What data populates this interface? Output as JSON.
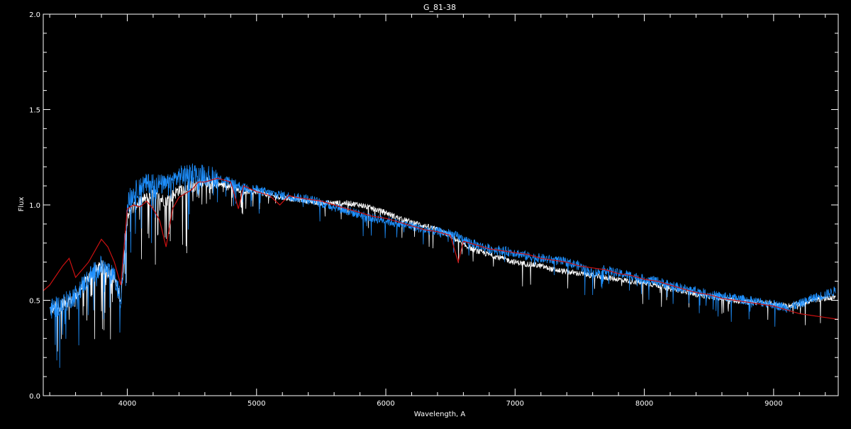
{
  "chart_data": {
    "type": "line",
    "title": "G_81-38",
    "xlabel": "Wavelength, A",
    "ylabel": "Flux",
    "xlim": [
      3350,
      9500
    ],
    "ylim": [
      0.0,
      2.0
    ],
    "x_ticks": [
      4000,
      5000,
      6000,
      7000,
      8000,
      9000
    ],
    "x_tick_labels": [
      "4000",
      "5000",
      "6000",
      "7000",
      "8000",
      "9000"
    ],
    "x_minor_step": 200,
    "y_ticks": [
      0.0,
      0.5,
      1.0,
      1.5,
      2.0
    ],
    "y_tick_labels": [
      "0.0",
      "0.5",
      "1.0",
      "1.5",
      "2.0"
    ],
    "y_minor_step": 0.1,
    "grid": false,
    "legend": "none",
    "background_color": "#000000",
    "axis_color": "#ffffff",
    "series": [
      {
        "color": "#ffffff",
        "points": [
          [
            3400,
            0.45
          ],
          [
            3500,
            0.48
          ],
          [
            3600,
            0.52
          ],
          [
            3700,
            0.62
          ],
          [
            3800,
            0.68
          ],
          [
            3900,
            0.62
          ],
          [
            3950,
            0.5
          ],
          [
            4000,
            0.95
          ],
          [
            4100,
            1.02
          ],
          [
            4200,
            1.05
          ],
          [
            4300,
            1.02
          ],
          [
            4400,
            1.08
          ],
          [
            4500,
            1.1
          ],
          [
            4600,
            1.12
          ],
          [
            4700,
            1.11
          ],
          [
            4800,
            1.1
          ],
          [
            4900,
            1.07
          ],
          [
            5000,
            1.07
          ],
          [
            5100,
            1.05
          ],
          [
            5200,
            1.04
          ],
          [
            5300,
            1.03
          ],
          [
            5400,
            1.02
          ],
          [
            5500,
            1.01
          ],
          [
            5600,
            1.01
          ],
          [
            5700,
            1.01
          ],
          [
            5800,
            1.0
          ],
          [
            5900,
            0.98
          ],
          [
            6000,
            0.96
          ],
          [
            6100,
            0.93
          ],
          [
            6200,
            0.91
          ],
          [
            6300,
            0.89
          ],
          [
            6400,
            0.87
          ],
          [
            6500,
            0.84
          ],
          [
            6600,
            0.79
          ],
          [
            6700,
            0.76
          ],
          [
            6800,
            0.74
          ],
          [
            6900,
            0.72
          ],
          [
            7000,
            0.7
          ],
          [
            7100,
            0.69
          ],
          [
            7200,
            0.68
          ],
          [
            7300,
            0.66
          ],
          [
            7400,
            0.65
          ],
          [
            7500,
            0.64
          ],
          [
            7600,
            0.63
          ],
          [
            7700,
            0.62
          ],
          [
            7800,
            0.61
          ],
          [
            7900,
            0.6
          ],
          [
            8000,
            0.59
          ],
          [
            8100,
            0.58
          ],
          [
            8200,
            0.56
          ],
          [
            8300,
            0.55
          ],
          [
            8400,
            0.53
          ],
          [
            8500,
            0.52
          ],
          [
            8600,
            0.51
          ],
          [
            8700,
            0.5
          ],
          [
            8800,
            0.49
          ],
          [
            8900,
            0.49
          ],
          [
            9000,
            0.48
          ],
          [
            9100,
            0.47
          ],
          [
            9200,
            0.48
          ],
          [
            9300,
            0.5
          ],
          [
            9400,
            0.51
          ],
          [
            9480,
            0.52
          ]
        ]
      },
      {
        "color": "#1e90ff",
        "points": [
          [
            3400,
            0.45
          ],
          [
            3500,
            0.48
          ],
          [
            3600,
            0.53
          ],
          [
            3700,
            0.62
          ],
          [
            3800,
            0.68
          ],
          [
            3900,
            0.62
          ],
          [
            3950,
            0.5
          ],
          [
            4000,
            1.02
          ],
          [
            4100,
            1.1
          ],
          [
            4200,
            1.12
          ],
          [
            4300,
            1.1
          ],
          [
            4400,
            1.15
          ],
          [
            4500,
            1.17
          ],
          [
            4600,
            1.16
          ],
          [
            4700,
            1.14
          ],
          [
            4800,
            1.12
          ],
          [
            4900,
            1.09
          ],
          [
            5000,
            1.08
          ],
          [
            5100,
            1.06
          ],
          [
            5200,
            1.05
          ],
          [
            5300,
            1.04
          ],
          [
            5400,
            1.03
          ],
          [
            5500,
            1.01
          ],
          [
            5600,
            0.99
          ],
          [
            5700,
            0.97
          ],
          [
            5800,
            0.95
          ],
          [
            5900,
            0.93
          ],
          [
            6000,
            0.92
          ],
          [
            6100,
            0.9
          ],
          [
            6200,
            0.89
          ],
          [
            6300,
            0.87
          ],
          [
            6400,
            0.86
          ],
          [
            6500,
            0.85
          ],
          [
            6600,
            0.82
          ],
          [
            6700,
            0.79
          ],
          [
            6800,
            0.77
          ],
          [
            6900,
            0.76
          ],
          [
            7000,
            0.75
          ],
          [
            7100,
            0.73
          ],
          [
            7200,
            0.72
          ],
          [
            7300,
            0.71
          ],
          [
            7400,
            0.7
          ],
          [
            7500,
            0.68
          ],
          [
            7600,
            0.64
          ],
          [
            7700,
            0.66
          ],
          [
            7800,
            0.64
          ],
          [
            7900,
            0.63
          ],
          [
            8000,
            0.61
          ],
          [
            8100,
            0.6
          ],
          [
            8200,
            0.58
          ],
          [
            8300,
            0.56
          ],
          [
            8400,
            0.55
          ],
          [
            8500,
            0.53
          ],
          [
            8600,
            0.52
          ],
          [
            8700,
            0.51
          ],
          [
            8800,
            0.5
          ],
          [
            8900,
            0.49
          ],
          [
            9000,
            0.48
          ],
          [
            9100,
            0.46
          ],
          [
            9200,
            0.48
          ],
          [
            9300,
            0.51
          ],
          [
            9400,
            0.53
          ],
          [
            9480,
            0.55
          ]
        ]
      },
      {
        "color": "#cc1111",
        "points": [
          [
            3350,
            0.55
          ],
          [
            3400,
            0.58
          ],
          [
            3450,
            0.63
          ],
          [
            3500,
            0.68
          ],
          [
            3550,
            0.72
          ],
          [
            3600,
            0.62
          ],
          [
            3650,
            0.66
          ],
          [
            3700,
            0.7
          ],
          [
            3750,
            0.76
          ],
          [
            3800,
            0.82
          ],
          [
            3850,
            0.78
          ],
          [
            3900,
            0.7
          ],
          [
            3950,
            0.58
          ],
          [
            4000,
            0.98
          ],
          [
            4050,
            1.0
          ],
          [
            4100,
            0.99
          ],
          [
            4150,
            1.02
          ],
          [
            4200,
            0.98
          ],
          [
            4250,
            0.92
          ],
          [
            4300,
            0.78
          ],
          [
            4350,
            0.98
          ],
          [
            4400,
            1.04
          ],
          [
            4450,
            1.06
          ],
          [
            4500,
            1.08
          ],
          [
            4550,
            1.12
          ],
          [
            4600,
            1.12
          ],
          [
            4650,
            1.13
          ],
          [
            4700,
            1.14
          ],
          [
            4800,
            1.12
          ],
          [
            4860,
            0.98
          ],
          [
            4900,
            1.1
          ],
          [
            5000,
            1.07
          ],
          [
            5100,
            1.05
          ],
          [
            5180,
            1.0
          ],
          [
            5250,
            1.05
          ],
          [
            5300,
            1.04
          ],
          [
            5400,
            1.03
          ],
          [
            5500,
            1.02
          ],
          [
            5600,
            1.0
          ],
          [
            5700,
            0.98
          ],
          [
            5800,
            0.96
          ],
          [
            5900,
            0.94
          ],
          [
            6000,
            0.93
          ],
          [
            6100,
            0.91
          ],
          [
            6200,
            0.89
          ],
          [
            6300,
            0.87
          ],
          [
            6400,
            0.86
          ],
          [
            6500,
            0.84
          ],
          [
            6560,
            0.7
          ],
          [
            6600,
            0.81
          ],
          [
            6700,
            0.79
          ],
          [
            6800,
            0.77
          ],
          [
            6900,
            0.76
          ],
          [
            7000,
            0.75
          ],
          [
            7100,
            0.74
          ],
          [
            7200,
            0.72
          ],
          [
            7300,
            0.71
          ],
          [
            7400,
            0.7
          ],
          [
            7500,
            0.68
          ],
          [
            7600,
            0.67
          ],
          [
            7700,
            0.66
          ],
          [
            7800,
            0.64
          ],
          [
            7900,
            0.63
          ],
          [
            8000,
            0.61
          ],
          [
            8100,
            0.6
          ],
          [
            8200,
            0.58
          ],
          [
            8300,
            0.56
          ],
          [
            8400,
            0.54
          ],
          [
            8500,
            0.53
          ],
          [
            8600,
            0.51
          ],
          [
            8700,
            0.5
          ],
          [
            8800,
            0.49
          ],
          [
            8900,
            0.48
          ],
          [
            9000,
            0.47
          ],
          [
            9100,
            0.45
          ],
          [
            9200,
            0.43
          ],
          [
            9300,
            0.42
          ],
          [
            9400,
            0.41
          ],
          [
            9500,
            0.4
          ]
        ]
      }
    ]
  }
}
